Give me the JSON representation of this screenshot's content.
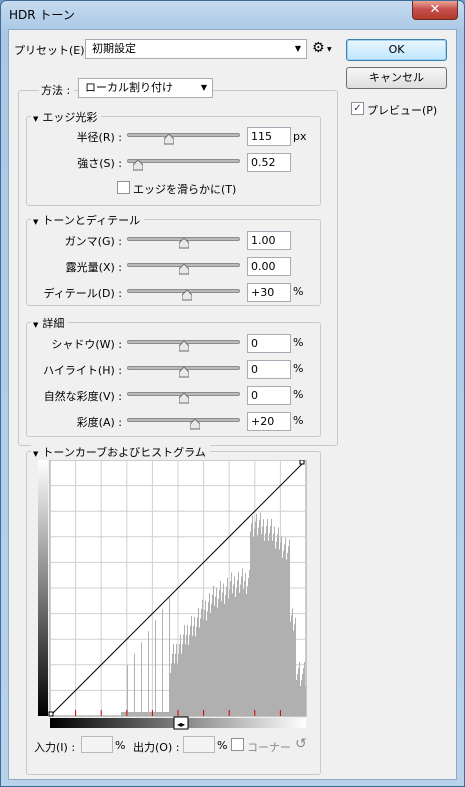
{
  "window": {
    "title": "HDR トーン",
    "close_glyph": "✕"
  },
  "preset": {
    "label": "プリセット(E) :",
    "value": "初期設定",
    "gear_glyph": "⚙"
  },
  "buttons": {
    "ok": "OK",
    "cancel": "キャンセル"
  },
  "preview": {
    "label": "プレビュー(P)",
    "checked": true
  },
  "method": {
    "label": "方法 :",
    "value": "ローカル割り付け"
  },
  "edge_glow": {
    "title": "エッジ光彩",
    "radius": {
      "label": "半径(R) :",
      "value": "115",
      "unit": "px",
      "level": 0.37
    },
    "strength": {
      "label": "強さ(S) :",
      "value": "0.52",
      "unit": "",
      "level": 0.1
    },
    "smooth_edges": {
      "label": "エッジを滑らかに(T)",
      "checked": false
    }
  },
  "tone_detail": {
    "title": "トーンとディテール",
    "gamma": {
      "label": "ガンマ(G) :",
      "value": "1.00",
      "unit": "",
      "level": 0.5
    },
    "exposure": {
      "label": "露光量(X) :",
      "value": "0.00",
      "unit": "",
      "level": 0.5
    },
    "detail": {
      "label": "ディテール(D) :",
      "value": "+30",
      "unit": "%",
      "level": 0.53
    }
  },
  "advanced": {
    "title": "詳細",
    "shadow": {
      "label": "シャドウ(W) :",
      "value": "0",
      "unit": "%",
      "level": 0.5
    },
    "highlight": {
      "label": "ハイライト(H) :",
      "value": "0",
      "unit": "%",
      "level": 0.5
    },
    "vibrance": {
      "label": "自然な彩度(V) :",
      "value": "0",
      "unit": "%",
      "level": 0.5
    },
    "saturation": {
      "label": "彩度(A) :",
      "value": "+20",
      "unit": "%",
      "level": 0.6
    }
  },
  "curve": {
    "title": "トーンカーブおよびヒストグラム",
    "input_label": "入力(I) :",
    "input_unit": "%",
    "output_label": "出力(O) :",
    "output_unit": "%",
    "corner_label": "コーナー",
    "reset_glyph": "↺"
  }
}
